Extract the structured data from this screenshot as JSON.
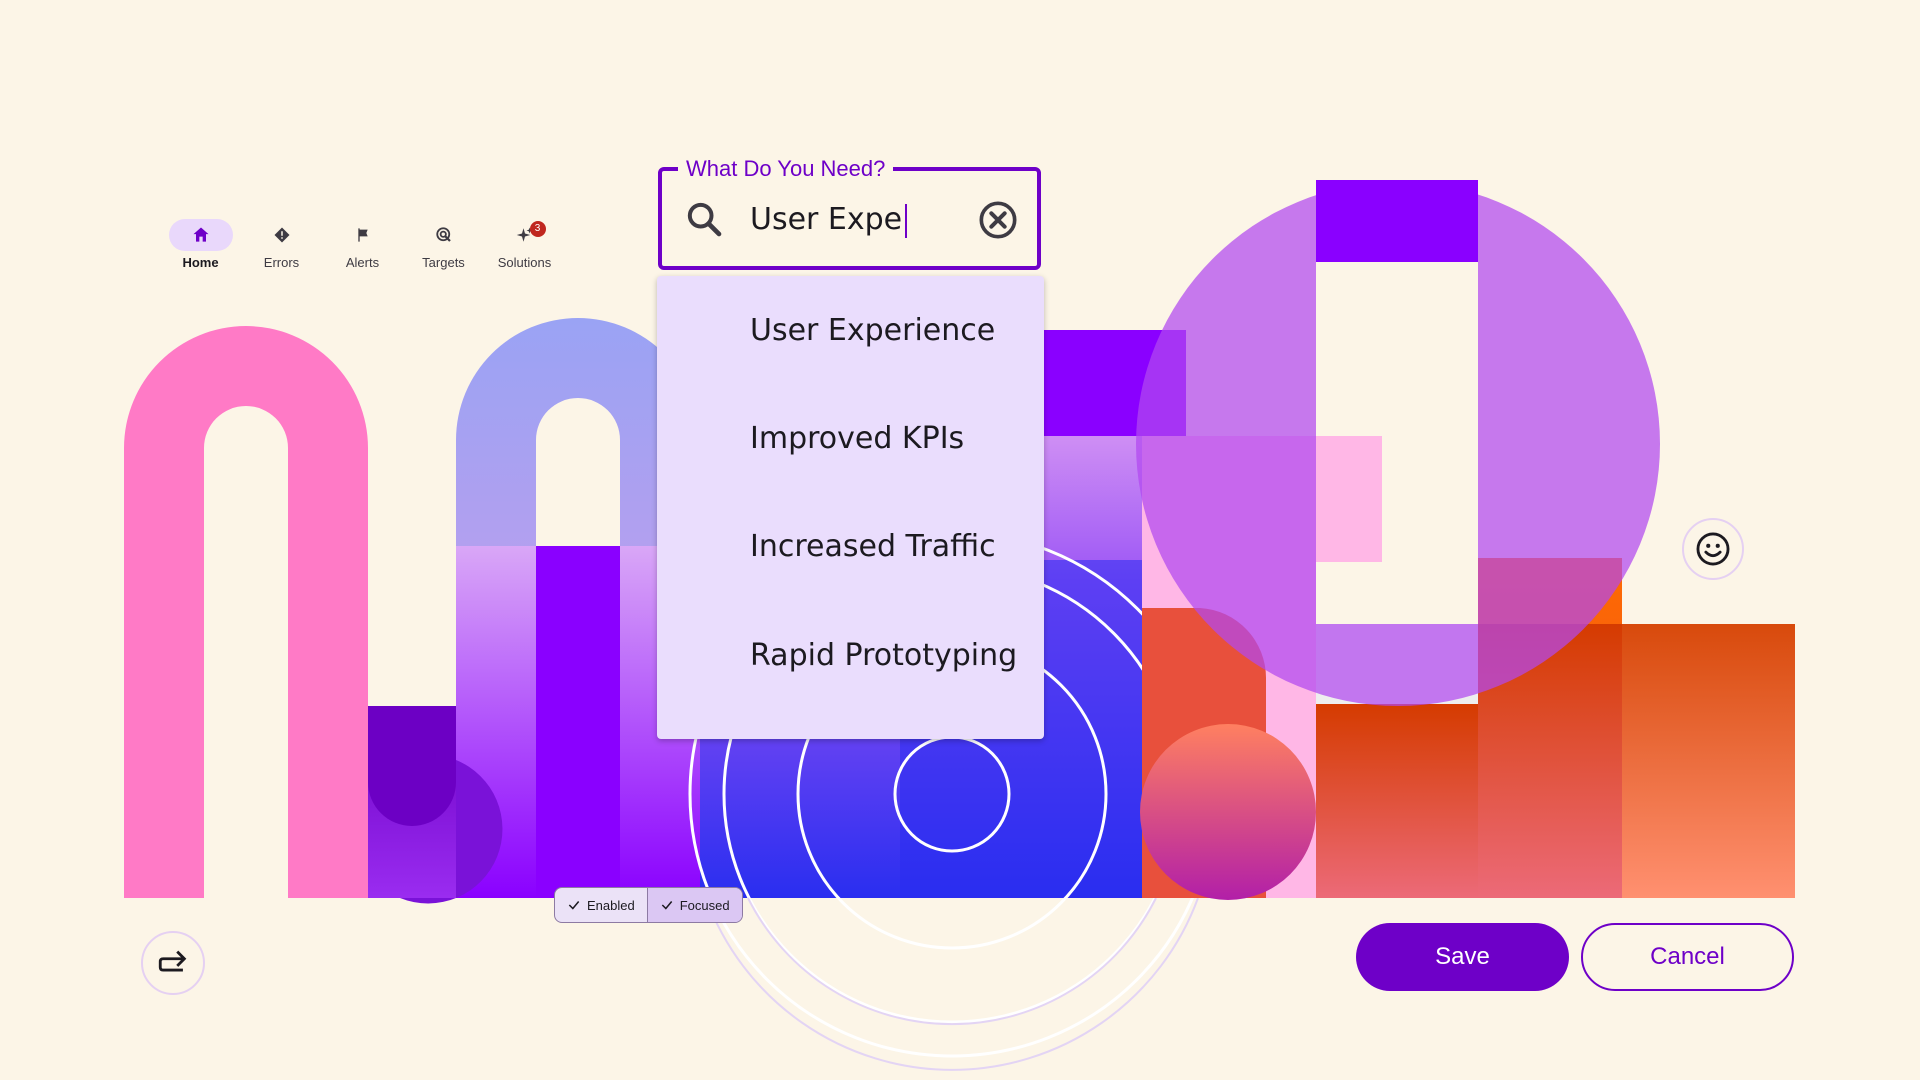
{
  "nav": {
    "items": [
      {
        "label": "Home",
        "icon": "home-icon",
        "active": true
      },
      {
        "label": "Errors",
        "icon": "error-diamond-icon"
      },
      {
        "label": "Alerts",
        "icon": "flag-icon"
      },
      {
        "label": "Targets",
        "icon": "target-icon"
      },
      {
        "label": "Solutions",
        "icon": "sparkle-icon",
        "badge": "3"
      }
    ]
  },
  "search": {
    "label": "What Do You Need?",
    "value": "User Expe",
    "suggestions": [
      "User Experience",
      "Improved KPIs",
      "Increased Traffic",
      "Rapid Prototyping"
    ]
  },
  "chips": [
    {
      "label": "Enabled",
      "selected": true
    },
    {
      "label": "Focused",
      "selected": true
    }
  ],
  "actions": {
    "save": "Save",
    "cancel": "Cancel"
  },
  "colors": {
    "background": "#fcf5e7",
    "primary": "#6e00c8",
    "menu": "#eaddfd",
    "pink": "#ff7ac6",
    "violet": "#8a00ff",
    "blue": "#2a2ef0",
    "orange": "#e8502b",
    "badge": "#c0271f"
  },
  "icons": {
    "share": "share-arrow-icon",
    "smiley": "smiley-icon",
    "clear": "cancel-circle-icon",
    "search": "search-icon"
  }
}
